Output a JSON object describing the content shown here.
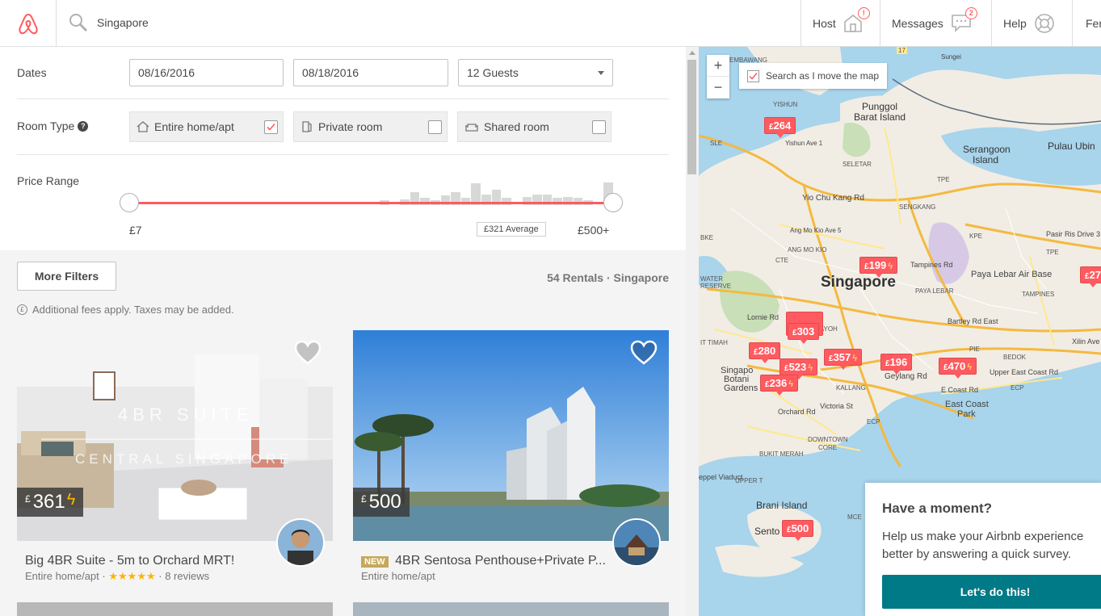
{
  "header": {
    "logo_icon": "airbnb-logo-icon",
    "search_value": "Singapore",
    "host_label": "Host",
    "host_badge": "!",
    "messages_label": "Messages",
    "messages_badge": "2",
    "help_label": "Help",
    "user_label": "Fer"
  },
  "filters": {
    "dates_label": "Dates",
    "checkin": "08/16/2016",
    "checkout": "08/18/2016",
    "guests": "12 Guests",
    "room_type_label": "Room Type",
    "room_types": [
      {
        "label": "Entire home/apt",
        "checked": true
      },
      {
        "label": "Private room",
        "checked": false
      },
      {
        "label": "Shared room",
        "checked": false
      }
    ],
    "price_range_label": "Price Range",
    "price_min": "£7",
    "price_max": "£500+",
    "price_average": "£321 Average",
    "histogram": [
      0.2,
      0,
      0.25,
      0.55,
      0.3,
      0.2,
      0.4,
      0.55,
      0.3,
      0.9,
      0.45,
      0.65,
      0.3,
      0,
      0.35,
      0.45,
      0.45,
      0.3,
      0.35,
      0.3,
      0.2,
      0,
      0.95
    ]
  },
  "results": {
    "more_filters": "More Filters",
    "count": "54 Rentals · Singapore",
    "fees_note": "Additional fees apply. Taxes may be added.",
    "listings": [
      {
        "currency": "£",
        "price": "361",
        "instant_book": true,
        "photo_overlay_1": "4BR SUITE",
        "photo_overlay_2": "CENTRAL SINGAPORE",
        "title": "Big 4BR Suite - 5m to Orchard MRT!",
        "room_type": "Entire home/apt",
        "stars": "★★★★★",
        "reviews": "· 8 reviews",
        "is_new": false
      },
      {
        "currency": "£",
        "price": "500",
        "instant_book": false,
        "title": "4BR Sentosa Penthouse+Private P...",
        "room_type": "Entire home/apt",
        "new_label": "NEW",
        "is_new": true
      }
    ]
  },
  "map": {
    "search_as_move": "Search as I move the map",
    "zoom_in": "+",
    "zoom_out": "−",
    "labels": {
      "city": "Singapore",
      "punggol": "Punggol",
      "barat_island": "Barat Island",
      "serangoon": "Serangoon",
      "serangoon2": "Island",
      "pulau_ubin": "Pulau Ubin",
      "airbase": "Paya Lebar Air Base",
      "brani": "Brani Island",
      "sentosa": "Sento",
      "east_coast": "East Coast",
      "east_coast2": "Park",
      "botanic": "Singapo",
      "botanic2": "Botani",
      "botanic3": "Gardens",
      "yishun": "YISHUN",
      "tampines": "TAMPINES",
      "bedok": "BEDOK",
      "kallang": "KALLANG",
      "downtown": "DOWNTOWN",
      "core": "CORE",
      "bukit_merah": "BUKIT MERAH",
      "ang_mo_kio": "ANG MO KIO",
      "sengkang": "SENGKANG",
      "seletar": "SELETAR",
      "paya_lebar": "PAYA LEBAR",
      "geylang": "Geylang Rd",
      "tampines_rd": "Tampines Rd",
      "upper_east": "Upper East Coast Rd",
      "e_coast_rd": "E Coast Rd",
      "xilin": "Xilin Ave",
      "lornie": "Lornie Rd",
      "bartley": "Bartley Rd East",
      "orchard": "Orchard Rd",
      "victoria": "Victoria St",
      "yio_chu_kang": "Yio Chu Kang Rd",
      "ang_mo_kio_ave": "Ang Mo Kio Ave 5",
      "yishun_ave": "Yishun Ave 1",
      "water": "WATER",
      "reserve": "RESERVE",
      "timah": "IT TIMAH",
      "viaduct": "eppel Viaduct",
      "mce": "MCE",
      "ecp": "ECP",
      "ecp2": "ECP",
      "tpe": "TPE",
      "pie": "PIE",
      "kpe": "KPE",
      "cte": "CTE",
      "sle": "SLE",
      "bke": "BKE",
      "pasir_ris": "Pasir Ris Drive 3",
      "rd17": "17",
      "pyo": "PAYOH",
      "embawang": "EMBAWANG",
      "sungei": "Sungei",
      "upper_t": "UPPER T",
      "tpe2": "TPE"
    },
    "pins": [
      {
        "currency": "£",
        "price": "264",
        "bolt": false
      },
      {
        "currency": "£",
        "price": "199",
        "bolt": true
      },
      {
        "currency": "£",
        "price": "27",
        "bolt": false
      },
      {
        "currency": "£",
        "price": "303",
        "bolt": false
      },
      {
        "currency": "£",
        "price": "280",
        "bolt": false
      },
      {
        "currency": "£",
        "price": "357",
        "bolt": true
      },
      {
        "currency": "£",
        "price": "196",
        "bolt": false
      },
      {
        "currency": "£",
        "price": "470",
        "bolt": true
      },
      {
        "currency": "£",
        "price": "523",
        "bolt": true
      },
      {
        "currency": "£",
        "price": "236",
        "bolt": true
      },
      {
        "currency": "£",
        "price": "500",
        "bolt": false
      }
    ]
  },
  "survey": {
    "heading": "Have a moment?",
    "body": "Help us make your Airbnb experience better by answering a quick survey.",
    "button": "Let's do this!"
  },
  "colors": {
    "brand": "#ff5a5f",
    "teal": "#007a87",
    "pin": "#ff5a5f"
  }
}
